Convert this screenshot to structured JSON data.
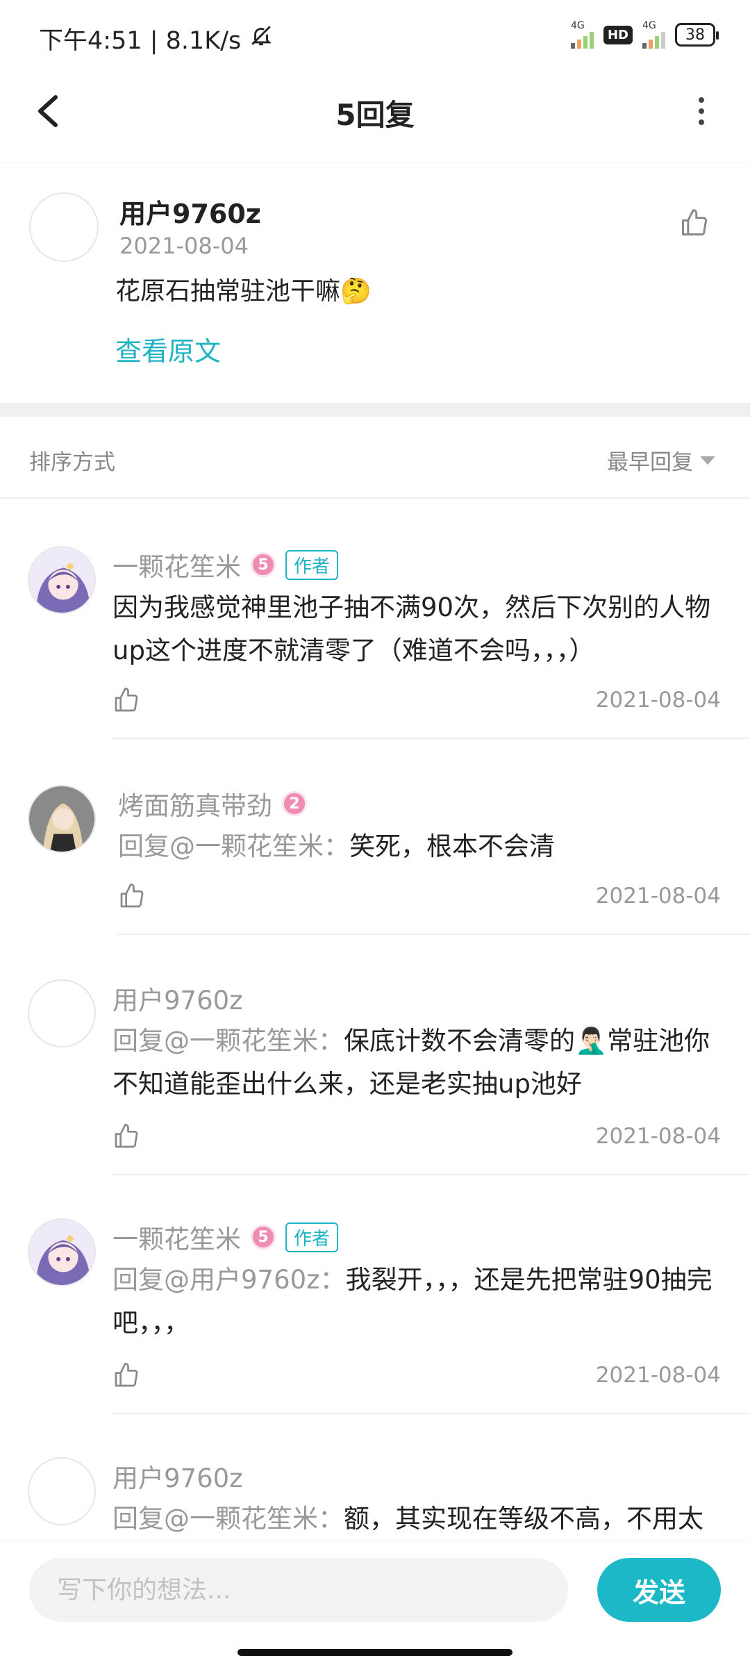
{
  "status_bar": {
    "time_speed": "下午4:51 | 8.1K/s",
    "network1": "4G",
    "network2": "4G",
    "hd": "HD",
    "battery": "38"
  },
  "header": {
    "title": "5回复"
  },
  "original": {
    "user": "用户9760z",
    "date": "2021-08-04",
    "text": "花原石抽常驻池干嘛🤔",
    "link": "查看原文"
  },
  "sort": {
    "label": "排序方式",
    "value": "最早回复"
  },
  "replies": [
    {
      "user": "一颗花笙米",
      "level": "5",
      "tag": "作者",
      "mention": "",
      "text": "因为我感觉神里池子抽不满90次，然后下次别的人物up这个进度不就清零了（难道不会吗，，，）",
      "date": "2021-08-04"
    },
    {
      "user": "烤面筋真带劲",
      "level": "2",
      "tag": "",
      "mention": "回复@一颗花笙米：",
      "text": "笑死，根本不会清",
      "date": "2021-08-04"
    },
    {
      "user": "用户9760z",
      "level": "",
      "tag": "",
      "mention": "回复@一颗花笙米：",
      "text": "保底计数不会清零的🤦🏻‍♂️常驻池你不知道能歪出什么来，还是老实抽up池好",
      "date": "2021-08-04"
    },
    {
      "user": "一颗花笙米",
      "level": "5",
      "tag": "作者",
      "mention": "回复@用户9760z：",
      "text": "我裂开，，，还是先把常驻90抽完吧，，，",
      "date": "2021-08-04"
    },
    {
      "user": "用户9760z",
      "level": "",
      "tag": "",
      "mention": "回复@一颗花笙米：",
      "text": "额，其实现在等级不高，不用太",
      "date": ""
    }
  ],
  "composer": {
    "placeholder": "写下你的想法...",
    "send_label": "发送"
  },
  "colors": {
    "accent": "#1cb8c8",
    "level_badge": "#f08cb4",
    "avatar_anime": "#7b6bb6"
  }
}
